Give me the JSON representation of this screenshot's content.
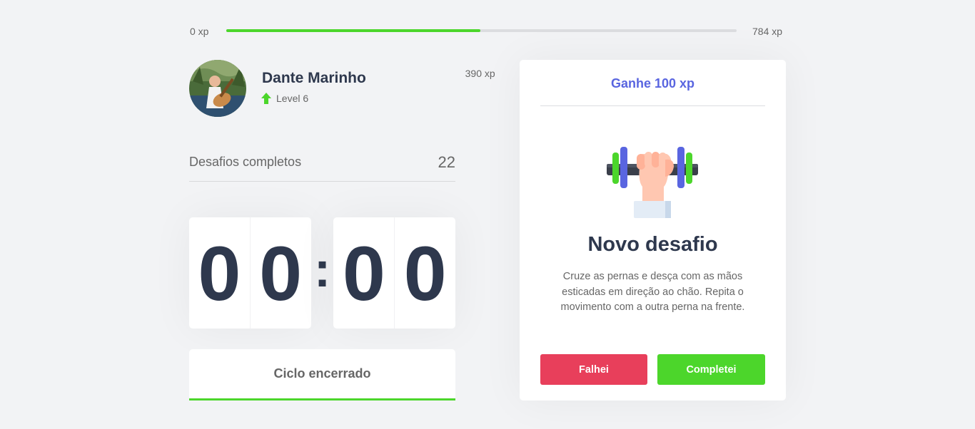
{
  "xp": {
    "min_label": "0 xp",
    "max_label": "784 xp",
    "current_label": "390 xp",
    "current": 390,
    "max": 784
  },
  "profile": {
    "name": "Dante Marinho",
    "level_label": "Level 6",
    "avatar_icon": "avatar-photo"
  },
  "stats": {
    "completed_label": "Desafios completos",
    "completed_count": "22"
  },
  "countdown": {
    "minute_left": "0",
    "minute_right": "0",
    "separator": ":",
    "second_left": "0",
    "second_right": "0"
  },
  "cycle_button": {
    "label": "Ciclo encerrado"
  },
  "challenge": {
    "header": "Ganhe 100 xp",
    "icon": "dumbbell-icon",
    "title": "Novo desafio",
    "description": "Cruze as pernas e desça com as mãos esticadas em direção ao chão. Repita o movimento com a outra perna na frente.",
    "fail_label": "Falhei",
    "success_label": "Completei"
  },
  "colors": {
    "background": "#f2f3f5",
    "green": "#4cd62b",
    "red": "#e83f5b",
    "blue": "#5965e0",
    "title": "#2e384d",
    "text": "#666666"
  }
}
